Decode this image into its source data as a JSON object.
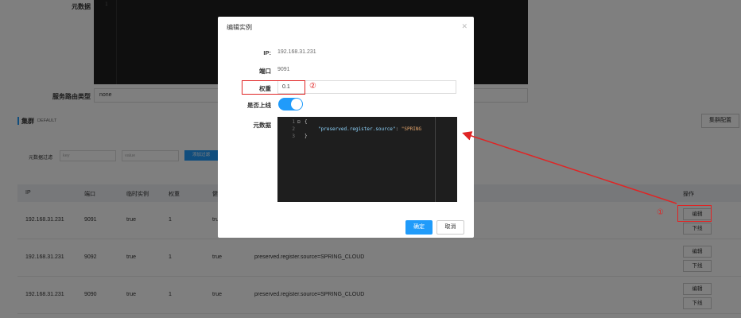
{
  "background": {
    "metadata_label": "元数据",
    "metadata_line": "1",
    "route_type_label": "服务路由类型",
    "route_type_value": "none",
    "cluster_title": "集群",
    "cluster_name": "DEFAULT",
    "cluster_config_button": "集群配置",
    "filter_label": "元数据过滤",
    "filter_key_placeholder": "key",
    "filter_value_placeholder": "value",
    "filter_add_button": "添加过滤",
    "table": {
      "headers": [
        "IP",
        "端口",
        "临时实例",
        "权重",
        "健",
        "操作"
      ],
      "rows": [
        {
          "ip": "192.168.31.231",
          "port": "9091",
          "ephemeral": "true",
          "weight": "1",
          "healthy": "tru",
          "metadata": "",
          "edit": "编辑",
          "offline": "下线"
        },
        {
          "ip": "192.168.31.231",
          "port": "9092",
          "ephemeral": "true",
          "weight": "1",
          "healthy": "true",
          "metadata": "preserved.register.source=SPRING_CLOUD",
          "edit": "编辑",
          "offline": "下线"
        },
        {
          "ip": "192.168.31.231",
          "port": "9090",
          "ephemeral": "true",
          "weight": "1",
          "healthy": "true",
          "metadata": "preserved.register.source=SPRING_CLOUD",
          "edit": "编辑",
          "offline": "下线"
        }
      ]
    }
  },
  "modal": {
    "title": "编辑实例",
    "close_icon": "close-icon",
    "ip_label": "IP:",
    "ip_value": "192.168.31.231",
    "port_label": "端口",
    "port_value": "9091",
    "weight_label": "权重",
    "weight_value": "0.1",
    "online_label": "是否上线",
    "online_enabled": true,
    "metadata_label": "元数据",
    "code_lines": [
      {
        "num": "1",
        "fold": "⊟",
        "text": "{"
      },
      {
        "num": "2",
        "fold": "",
        "key": "\"preserved.register.source\"",
        "sep": ": ",
        "value": "\"SPRING"
      },
      {
        "num": "3",
        "fold": "",
        "text": "}"
      }
    ],
    "ok_button": "确定",
    "cancel_button": "取消"
  },
  "annotations": {
    "marker_1": "①",
    "marker_2": "②",
    "color": "#e02424"
  },
  "colors": {
    "accent": "#209bfa",
    "overlay": "rgba(0,0,0,0.5)"
  }
}
